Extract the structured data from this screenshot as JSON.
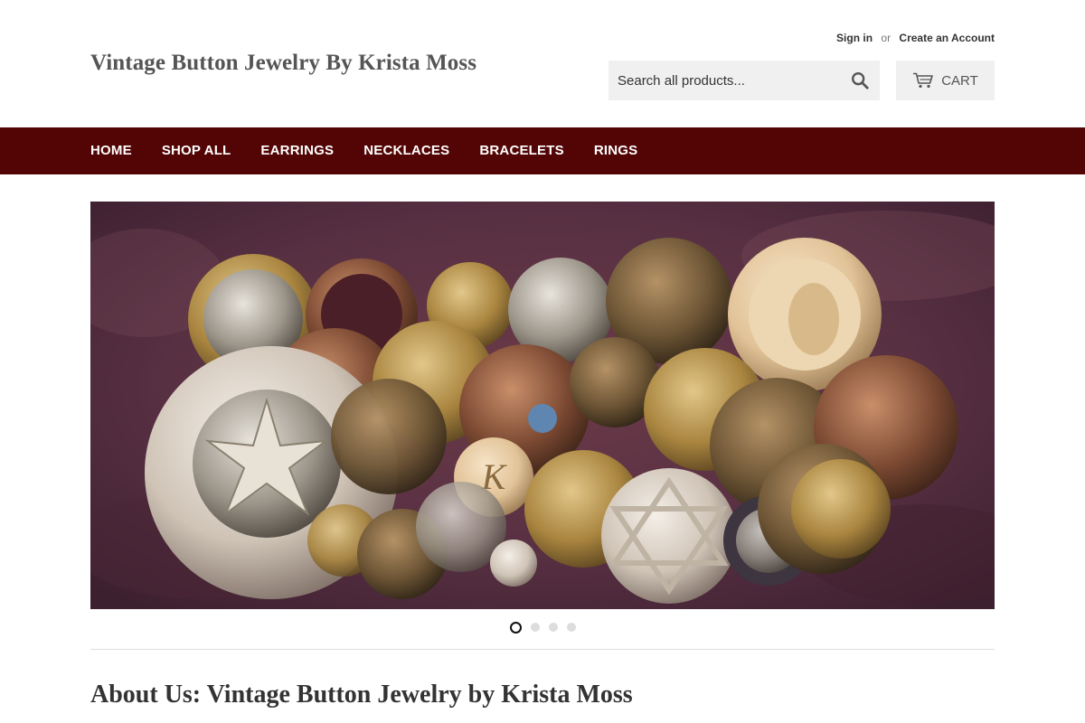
{
  "site": {
    "title": "Vintage Button Jewelry By Krista Moss"
  },
  "account": {
    "sign_in": "Sign in",
    "or": "or",
    "create_account": "Create an Account"
  },
  "search": {
    "placeholder": "Search all products..."
  },
  "cart": {
    "label": "CART"
  },
  "nav": {
    "items": [
      {
        "label": "HOME"
      },
      {
        "label": "SHOP ALL"
      },
      {
        "label": "EARRINGS"
      },
      {
        "label": "NECKLACES"
      },
      {
        "label": "BRACELETS"
      },
      {
        "label": "RINGS"
      }
    ]
  },
  "slideshow": {
    "slide_count": 4,
    "active_index": 0
  },
  "about": {
    "title": "About Us: Vintage Button Jewelry by Krista Moss"
  },
  "colors": {
    "nav_bg": "#530505",
    "velvet": "#5e2f3d",
    "brass": "#b08d4e"
  }
}
